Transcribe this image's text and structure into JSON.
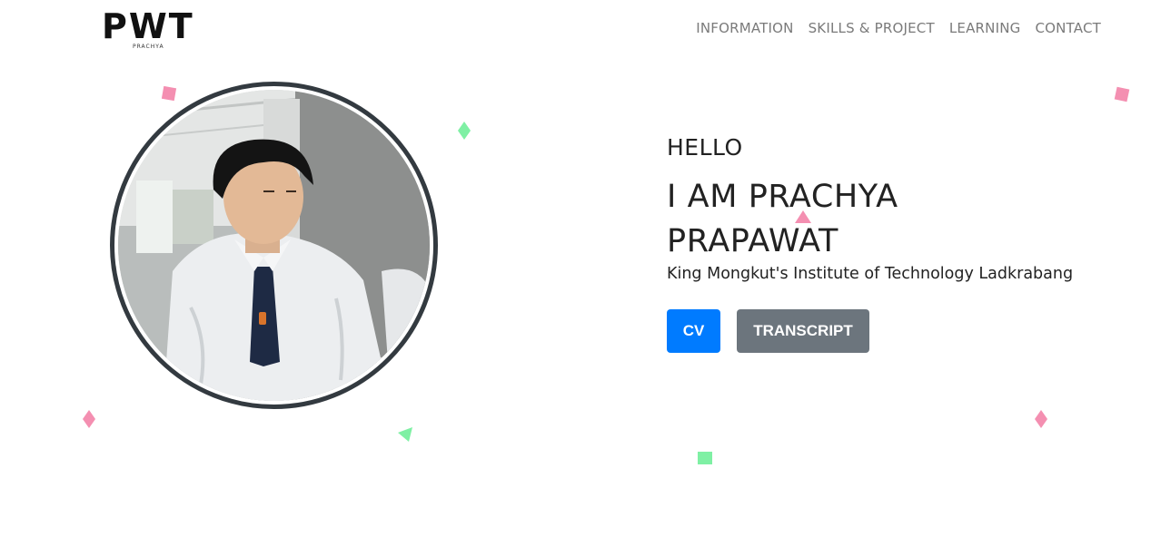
{
  "header": {
    "logo_text": "PWT",
    "logo_sub": "PRACHYA",
    "nav": [
      {
        "label": "INFORMATION"
      },
      {
        "label": "SKILLS & PROJECT"
      },
      {
        "label": "LEARNING"
      },
      {
        "label": "CONTACT"
      }
    ]
  },
  "hero": {
    "greeting": "HELLO",
    "name": "I AM PRACHYA PRAPAWAT",
    "school": "King Mongkut's Institute of Technology Ladkrabang",
    "buttons": {
      "cv": "CV",
      "transcript": "TRANSCRIPT"
    }
  },
  "colors": {
    "primary": "#007bff",
    "secondary": "#6c757d",
    "confetti_pink": "#f48fb1",
    "confetti_green": "#7ff0a4",
    "avatar_border": "#333a40"
  }
}
